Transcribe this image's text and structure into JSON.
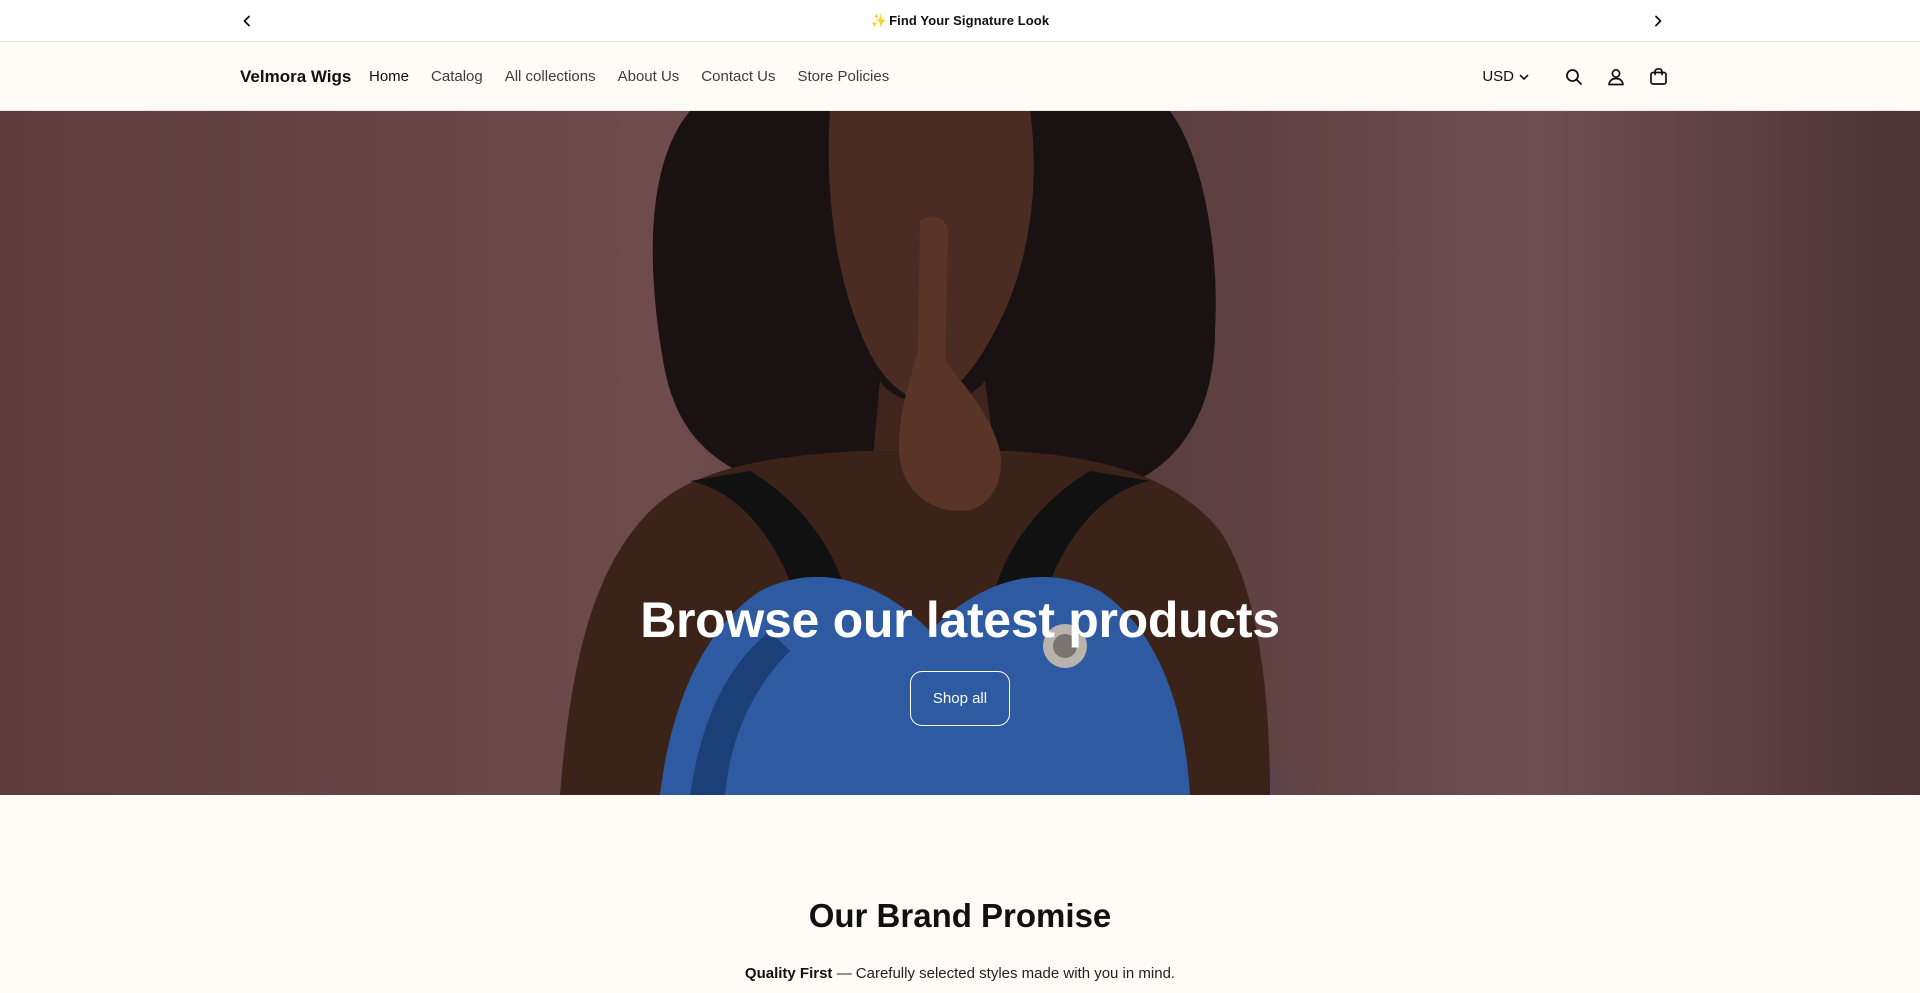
{
  "announcement": {
    "sparkle": "✨",
    "text": "Find Your Signature Look",
    "prev_icon": "chevron-left-icon",
    "next_icon": "chevron-right-icon"
  },
  "header": {
    "brand": "Velmora Wigs",
    "nav": [
      {
        "label": "Home",
        "active": true
      },
      {
        "label": "Catalog"
      },
      {
        "label": "All collections"
      },
      {
        "label": "About Us"
      },
      {
        "label": "Contact Us"
      },
      {
        "label": "Store Policies"
      }
    ],
    "currency": "USD",
    "icons": [
      "search-icon",
      "account-icon",
      "cart-icon"
    ]
  },
  "hero": {
    "title": "Browse our latest products",
    "button": "Shop all"
  },
  "promise": {
    "heading": "Our Brand Promise",
    "item_strong": "Quality First",
    "item_text": " — Carefully selected styles made with you in mind."
  },
  "colors": {
    "background": "#fffcf7",
    "hero_text": "#ffffff",
    "text": "#111111"
  }
}
